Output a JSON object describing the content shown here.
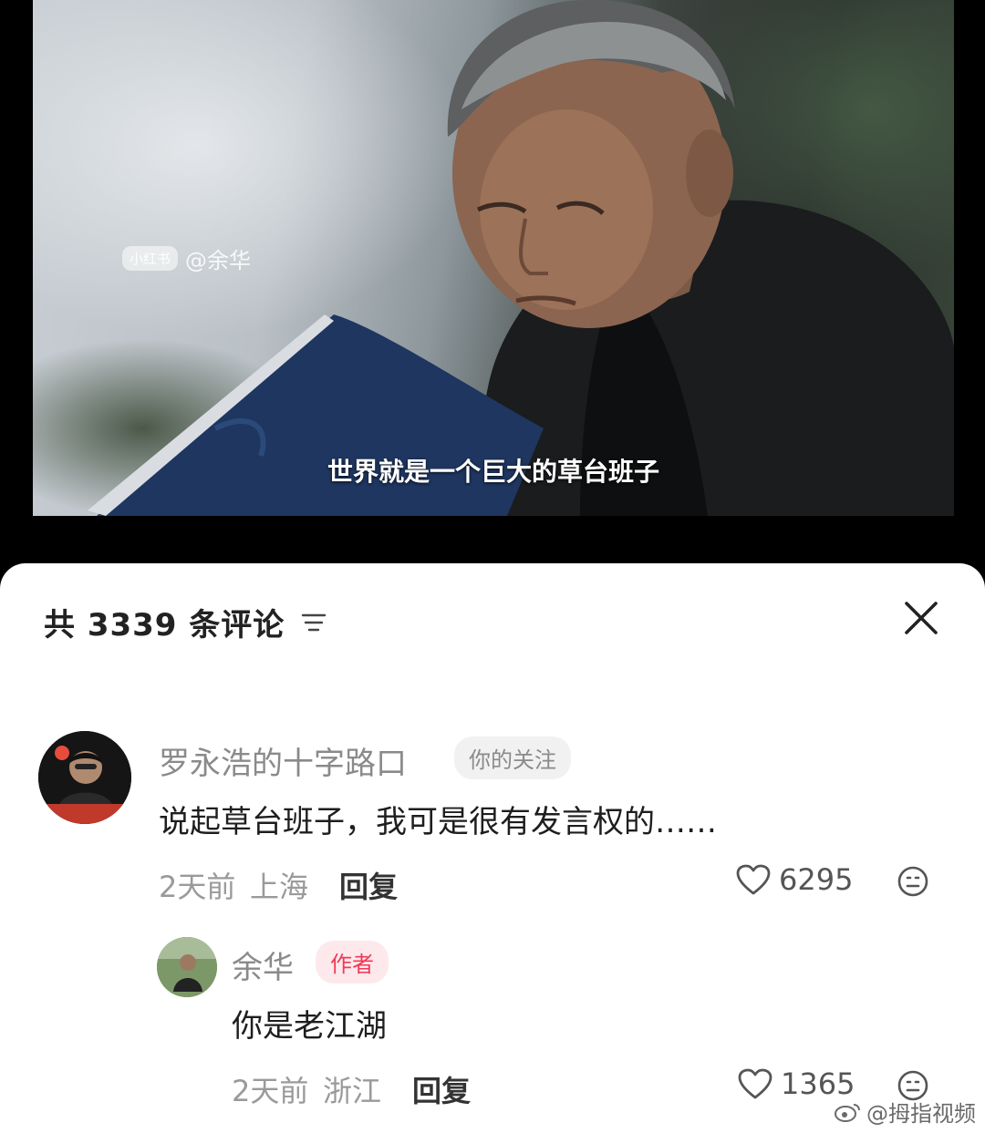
{
  "video": {
    "watermark_logo": "小红书",
    "watermark_handle": "@余华",
    "subtitle": "世界就是一个巨大的草台班子"
  },
  "comments_sheet": {
    "title": "共 3339 条评论",
    "sort_icon": "sort-lines-icon",
    "close_icon": "close-x-icon"
  },
  "comments": [
    {
      "username": "罗永浩的十字路口",
      "tag": "你的关注",
      "avatar_caption": "罗永浩的十字路口",
      "text": "说起草台班子，我可是很有发言权的……",
      "time": "2天前",
      "location": "上海",
      "reply_label": "回复",
      "likes": "6295"
    },
    {
      "username": "余华",
      "tag": "作者",
      "text": "你是老江湖",
      "time": "2天前",
      "location": "浙江",
      "reply_label": "回复",
      "likes": "1365"
    }
  ],
  "corner_watermark": "@拇指视频",
  "colors": {
    "author_tag": "#ef3a56",
    "author_tag_bg": "#fde9ec",
    "meta_gray": "#9a9a9a"
  }
}
